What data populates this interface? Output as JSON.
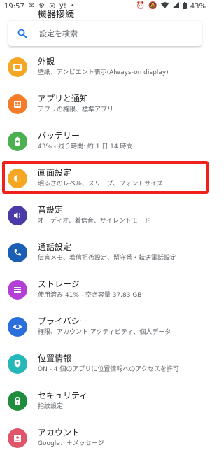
{
  "status": {
    "time": "19:57",
    "battery": "43%"
  },
  "clipped_title": "機器接続",
  "search": {
    "placeholder": "設定を検索"
  },
  "colors": {
    "display_icon": "#f5a623",
    "apps_icon": "#f57c2b",
    "battery_icon": "#4caf50",
    "sound_icon": "#4a3aa8",
    "call_icon": "#1a5fb4",
    "storage_icon": "#b43fd6",
    "privacy_icon": "#2a6fdb",
    "location_icon": "#26b8b8",
    "security_icon": "#1e8e3e",
    "account_icon": "#e0556a",
    "highlight": "#f2201a"
  },
  "items": [
    {
      "title": "外観",
      "sub": "壁紙、アンビエント表示(Always-on display)",
      "icon": "palette-icon"
    },
    {
      "title": "アプリと通知",
      "sub": "アプリの権限、標準アプリ",
      "icon": "apps-icon"
    },
    {
      "title": "バッテリー",
      "sub": "43% - 残り時間: 約 1 日 14 時間",
      "icon": "battery-icon"
    },
    {
      "title": "画面設定",
      "sub": "明るさのレベル、スリープ、フォントサイズ",
      "icon": "brightness-icon"
    },
    {
      "title": "音設定",
      "sub": "オーディオ、着信音、サイレントモード",
      "icon": "volume-icon"
    },
    {
      "title": "通話設定",
      "sub": "伝言メモ、着信拒否設定、留守番・転送電話設定",
      "icon": "phone-icon"
    },
    {
      "title": "ストレージ",
      "sub": "使用済み 41% - 空き容量 37.83 GB",
      "icon": "storage-icon"
    },
    {
      "title": "プライバシー",
      "sub": "権限、アカウント アクティビティ、個人データ",
      "icon": "eye-icon"
    },
    {
      "title": "位置情報",
      "sub": "ON - 4 個のアプリに位置情報へのアクセスを許可",
      "icon": "location-pin-icon"
    },
    {
      "title": "セキュリティ",
      "sub": "指紋設定",
      "icon": "lock-icon"
    },
    {
      "title": "アカウント",
      "sub": "Google、＋メッセージ",
      "icon": "account-icon"
    }
  ]
}
